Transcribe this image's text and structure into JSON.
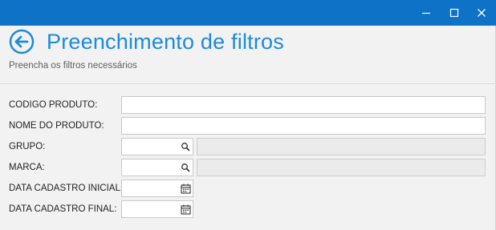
{
  "window": {
    "controls": [
      {
        "name": "minimize",
        "icon": "minimize-icon"
      },
      {
        "name": "maximize",
        "icon": "maximize-icon"
      },
      {
        "name": "close",
        "icon": "close-icon"
      }
    ],
    "title_bar_color": "#0e72c6"
  },
  "header": {
    "back_icon": "back-arrow-icon",
    "title": "Preenchimento de filtros",
    "subtitle": "Preencha os filtros necessários",
    "accent_color": "#1e8bd8"
  },
  "form": {
    "codigo_produto": {
      "label": "CODIGO PRODUTO:",
      "value": ""
    },
    "nome_produto": {
      "label": "NOME DO PRODUTO:",
      "value": ""
    },
    "grupo": {
      "label": "GRUPO:",
      "value": "",
      "description": "",
      "icon": "search-icon"
    },
    "marca": {
      "label": "MARCA:",
      "value": "",
      "description": "",
      "icon": "search-icon"
    },
    "data_cadastro_inicial": {
      "label": "DATA CADASTRO INICIAL:",
      "value": "",
      "icon": "calendar-icon"
    },
    "data_cadastro_final": {
      "label": "DATA CADASTRO FINAL:",
      "value": "",
      "icon": "calendar-icon"
    }
  }
}
